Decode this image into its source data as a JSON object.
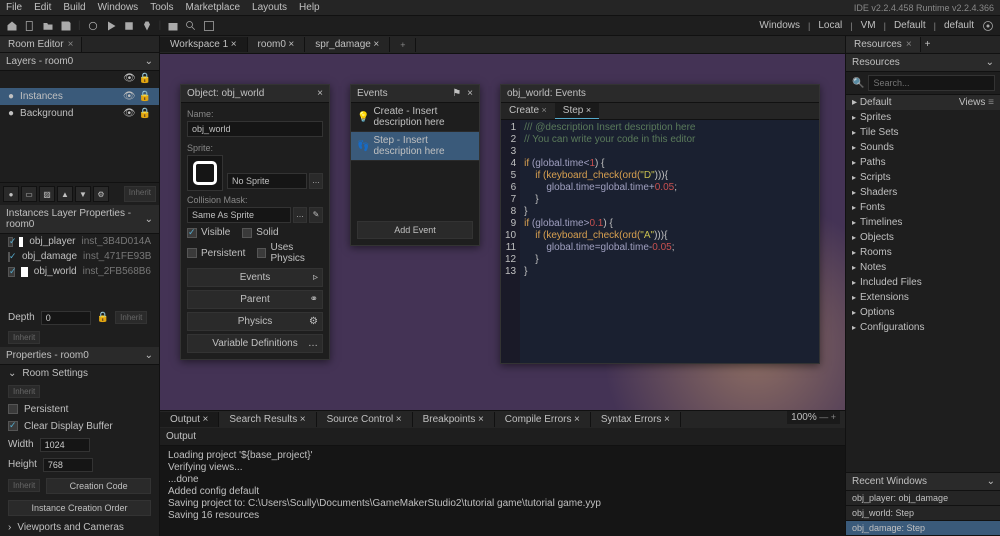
{
  "menu": [
    "File",
    "Edit",
    "Build",
    "Windows",
    "Tools",
    "Marketplace",
    "Layouts",
    "Help"
  ],
  "ide_info": "IDE v2.2.4.458  Runtime v2.2.4.366",
  "status_right": [
    "Windows",
    "Local",
    "VM",
    "Default",
    "default"
  ],
  "left": {
    "room_editor_tab": "Room Editor",
    "layers_header": "Layers - room0",
    "layers": [
      {
        "name": "Instances",
        "sel": true
      },
      {
        "name": "Background",
        "sel": false
      }
    ],
    "inst_header": "Instances Layer Properties - room0",
    "instances": [
      {
        "obj": "obj_player",
        "inst": "inst_3B4D014A",
        "col": "#ffffff"
      },
      {
        "obj": "obj_damage",
        "inst": "inst_471FE93B",
        "col": "#c02020"
      },
      {
        "obj": "obj_world",
        "inst": "inst_2FB568B6",
        "col": "#ffffff"
      }
    ],
    "depth_label": "Depth",
    "depth_value": "0",
    "inherit": "Inherit",
    "properties_header": "Properties - room0",
    "room_settings": "Room Settings",
    "persistent": "Persistent",
    "clear_display": "Clear Display Buffer",
    "width_label": "Width",
    "width_value": "1024",
    "height_label": "Height",
    "height_value": "768",
    "creation_code": "Creation Code",
    "inst_creation_order": "Instance Creation Order",
    "viewports": "Viewports and Cameras"
  },
  "center_tabs": [
    {
      "label": "Workspace 1",
      "active": true
    },
    {
      "label": "room0",
      "active": false
    },
    {
      "label": "spr_damage",
      "active": false
    }
  ],
  "obj_panel": {
    "title": "Object: obj_world",
    "name_label": "Name:",
    "name_value": "obj_world",
    "sprite_label": "Sprite:",
    "sprite_value": "No Sprite",
    "collision_label": "Collision Mask:",
    "collision_value": "Same As Sprite",
    "visible": "Visible",
    "solid": "Solid",
    "persistent": "Persistent",
    "uses_physics": "Uses Physics",
    "btn_events": "Events",
    "btn_parent": "Parent",
    "btn_physics": "Physics",
    "btn_vardef": "Variable Definitions"
  },
  "events_panel": {
    "title": "Events",
    "items": [
      {
        "label": "Create - Insert description here",
        "sel": false
      },
      {
        "label": "Step - Insert description here",
        "sel": true
      }
    ],
    "add": "Add Event"
  },
  "code_panel": {
    "title": "obj_world: Events",
    "tabs": [
      {
        "label": "Create",
        "active": false
      },
      {
        "label": "Step",
        "active": true
      }
    ],
    "lines": [
      "1",
      "2",
      "3",
      "4",
      "5",
      "6",
      "7",
      "8",
      "9",
      "10",
      "11",
      "12",
      "13"
    ]
  },
  "code_text": {
    "l1": "/// @description Insert description here",
    "l2": "// You can write your code in this editor",
    "l4a": "if",
    "l4b": " (global.time<",
    "l4c": "1",
    "l4d": ") {",
    "l5a": "    if",
    "l5b": " (keyboard_check(ord(",
    "l5c": "\"D\"",
    "l5d": "))){",
    "l6a": "        global.time=global.time+",
    "l6b": "0.05",
    "l6c": ";",
    "l7": "    }",
    "l8": "}",
    "l9a": "if",
    "l9b": " (global.time>",
    "l9c": "0.1",
    "l9d": ") {",
    "l10a": "    if",
    "l10b": " (keyboard_check(ord(",
    "l10c": "\"A\"",
    "l10d": "))){",
    "l11a": "        global.time=global.time-",
    "l11b": "0.05",
    "l11c": ";",
    "l12": "    }",
    "l13": "}"
  },
  "output_tabs": [
    "Output",
    "Search Results",
    "Source Control",
    "Breakpoints",
    "Compile Errors",
    "Syntax Errors"
  ],
  "output_sub": "Output",
  "output_lines": [
    "Loading project '${base_project}'",
    "Verifying views...",
    "...done",
    "Added config default",
    "Saving project to: C:\\Users\\Scully\\Documents\\GameMakerStudio2\\tutorial game\\tutorial game.yyp",
    "Saving 16 resources"
  ],
  "resources": {
    "tab": "Resources",
    "header": "Resources",
    "search_placeholder": "Search...",
    "default": "Default",
    "views": "Views",
    "tree": [
      "Sprites",
      "Tile Sets",
      "Sounds",
      "Paths",
      "Scripts",
      "Shaders",
      "Fonts",
      "Timelines",
      "Objects",
      "Rooms",
      "Notes",
      "Included Files",
      "Extensions",
      "Options",
      "Configurations"
    ]
  },
  "zoom": "100%",
  "recent": {
    "header": "Recent Windows",
    "items": [
      "obj_player: obj_damage",
      "obj_world: Step",
      "obj_damage: Step"
    ]
  }
}
